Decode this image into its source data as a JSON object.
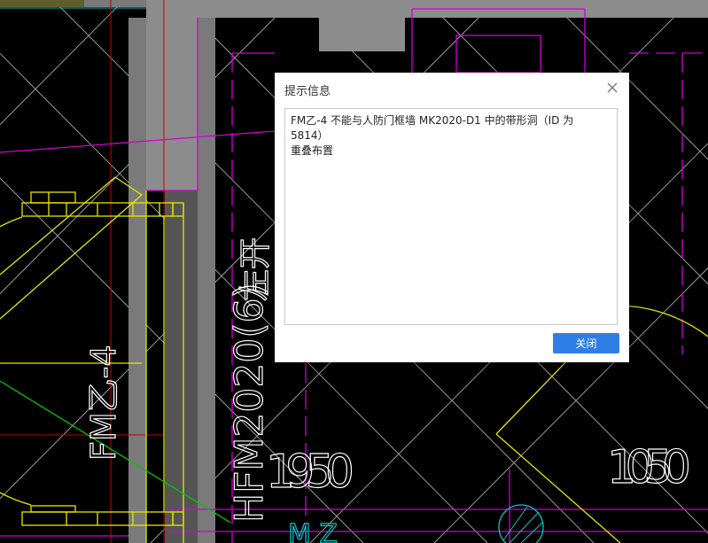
{
  "drawing": {
    "labels": {
      "door_code": "FM乙-4",
      "side_text": "左开",
      "door_frame_code": "HFM2020(6)",
      "dim_left": "1950",
      "dim_right": "1050",
      "partial_mark": "M Z"
    },
    "colors": {
      "background": "#000000",
      "wall_gray": "#8c8c8c",
      "column_gray": "#7a7a7a",
      "magenta": "#d400d4",
      "yellow": "#e6e600",
      "red": "#c80000",
      "white_line": "#bfbfbf",
      "green": "#00c800",
      "cyan": "#00c8c8"
    }
  },
  "dialog": {
    "title": "提示信息",
    "close_icon": "close-icon",
    "message": "FM乙-4 不能与人防门框墙 MK2020-D1 中的带形洞（ID 为 5814）\n重叠布置",
    "close_button_label": "关闭"
  }
}
